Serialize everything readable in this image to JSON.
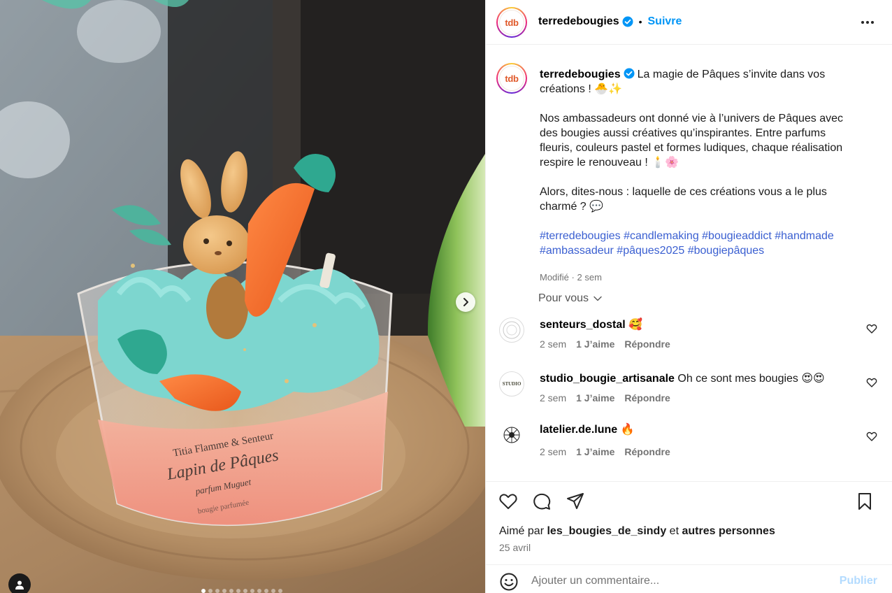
{
  "post": {
    "account": "terredebougies",
    "avatar_text": "tdb",
    "follow_label": "Suivre",
    "separator": "•",
    "more_icon": "more-horizontal-icon",
    "verified_icon": "verified-badge-icon"
  },
  "caption": {
    "username": "terredebougies",
    "line1": "La magie de Pâques s’invite dans vos créations ! 🐣✨",
    "para2": "Nos ambassadeurs ont donné vie à l’univers de Pâques avec des bougies aussi créatives qu’inspirantes. Entre parfums fleuris, couleurs pastel et formes ludiques, chaque réalisation respire le renouveau ! 🕯️🌸",
    "para3": "Alors, dites-nous : laquelle de ces créations vous a le plus charmé ? 💬",
    "hashtags": "#terredebougies #candlemaking #bougieaddict #handmade #ambassadeur #pâques2025 #bougiepâques",
    "edited": "Modifié",
    "dot": "·",
    "time": "2 sem"
  },
  "for_you": "Pour vous",
  "comments": [
    {
      "username": "senteurs_dostal",
      "text": "🥰",
      "time": "2 sem",
      "likes": "1 J’aime",
      "reply": "Répondre"
    },
    {
      "username": "studio_bougie_artisanale",
      "text": "Oh ce sont mes bougies 😍😍",
      "time": "2 sem",
      "likes": "1 J’aime",
      "reply": "Répondre",
      "avatar_text": "STUDIO"
    },
    {
      "username": "latelier.de.lune",
      "text": "🔥",
      "time": "2 sem",
      "likes": "1 J’aime",
      "reply": "Répondre"
    }
  ],
  "likes": {
    "prefix": "Aimé par",
    "user": "les_bougies_de_sindy",
    "and": "et",
    "others": "autres personnes"
  },
  "date": "25 avril",
  "add_comment": {
    "placeholder": "Ajouter un commentaire...",
    "publish": "Publier"
  },
  "photo": {
    "label_brand": "Titia Flamme & Senteur",
    "label_name": "Lapin de Pâques",
    "label_scent": "parfum Muguet",
    "label_type": "bougie parfumée",
    "carousel_count": 12,
    "carousel_active": 1
  },
  "colors": {
    "link_blue": "#0095f6",
    "hashtag_blue": "#3a5fd1",
    "muted_text": "#737373",
    "publish_disabled": "#b3dbff"
  }
}
